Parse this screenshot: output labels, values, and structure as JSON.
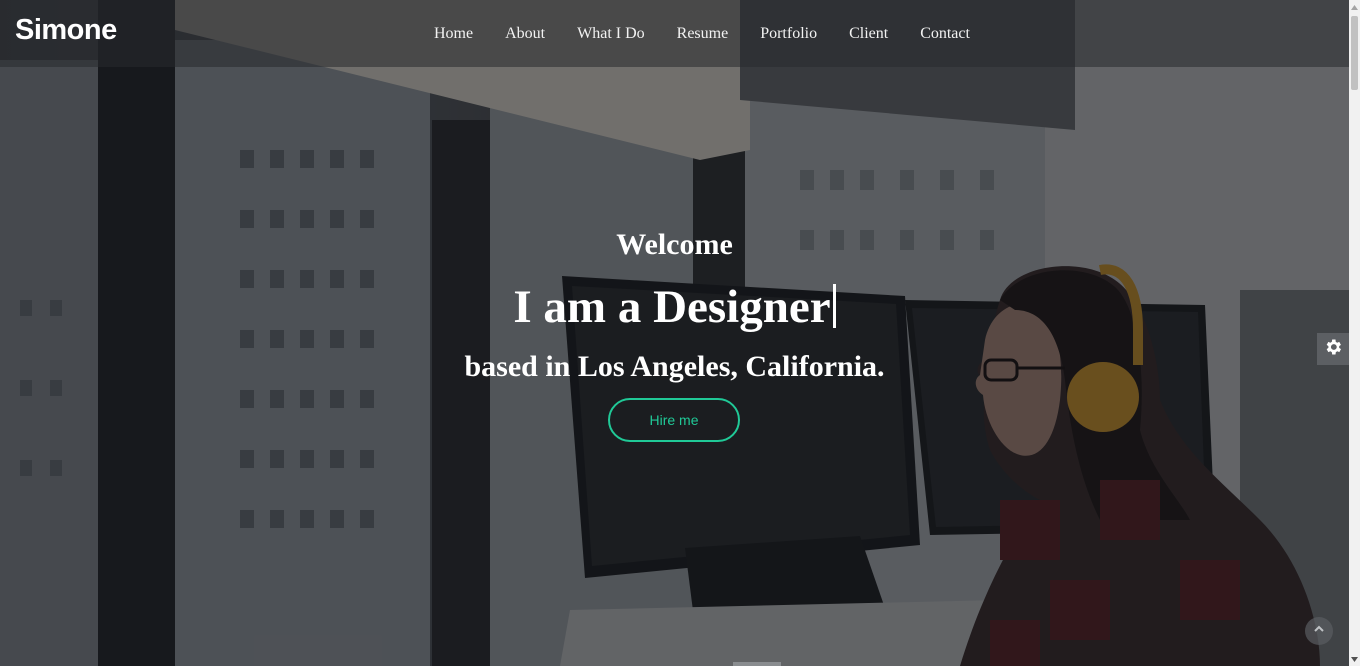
{
  "brand": "Simone",
  "nav": {
    "items": [
      "Home",
      "About",
      "What I Do",
      "Resume",
      "Portfolio",
      "Client",
      "Contact"
    ]
  },
  "hero": {
    "welcome": "Welcome",
    "headline": "I am a Designer",
    "location": "based in Los Angeles, California.",
    "cta_label": "Hire me"
  },
  "colors": {
    "accent": "#20c997",
    "text": "#ffffff"
  },
  "icons": {
    "settings": "gear-icon",
    "back_to_top": "chevron-up-icon"
  }
}
